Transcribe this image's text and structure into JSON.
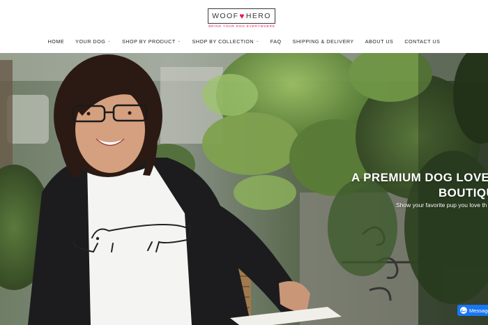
{
  "header": {
    "logo": {
      "left_text": "WOOF",
      "heart": "♥",
      "right_text": "HERO"
    },
    "tagline": "BRING YOUR DOG EVERYWHERE"
  },
  "nav": {
    "items": [
      {
        "label": "HOME",
        "has_dropdown": false
      },
      {
        "label": "YOUR DOG",
        "has_dropdown": true
      },
      {
        "label": "SHOP BY PRODUCT",
        "has_dropdown": true
      },
      {
        "label": "SHOP BY COLLECTION",
        "has_dropdown": true
      },
      {
        "label": "FAQ",
        "has_dropdown": false
      },
      {
        "label": "SHIPPING & DELIVERY",
        "has_dropdown": false
      },
      {
        "label": "ABOUT US",
        "has_dropdown": false
      },
      {
        "label": "CONTACT US",
        "has_dropdown": false
      }
    ],
    "dropdown_icon": "chevron-down-icon"
  },
  "hero": {
    "title_line1": "A PREMIUM DOG LOVER",
    "title_line2": "BOUTIQU",
    "subtitle": "Show your favorite pup you love th",
    "image": "woman-in-dachshund-tshirt-photo"
  },
  "chat": {
    "label": "Message",
    "icon": "messenger-icon"
  },
  "colors": {
    "brand_pink": "#e8174f",
    "messenger_blue": "#1877f2",
    "nav_text": "#222222"
  }
}
